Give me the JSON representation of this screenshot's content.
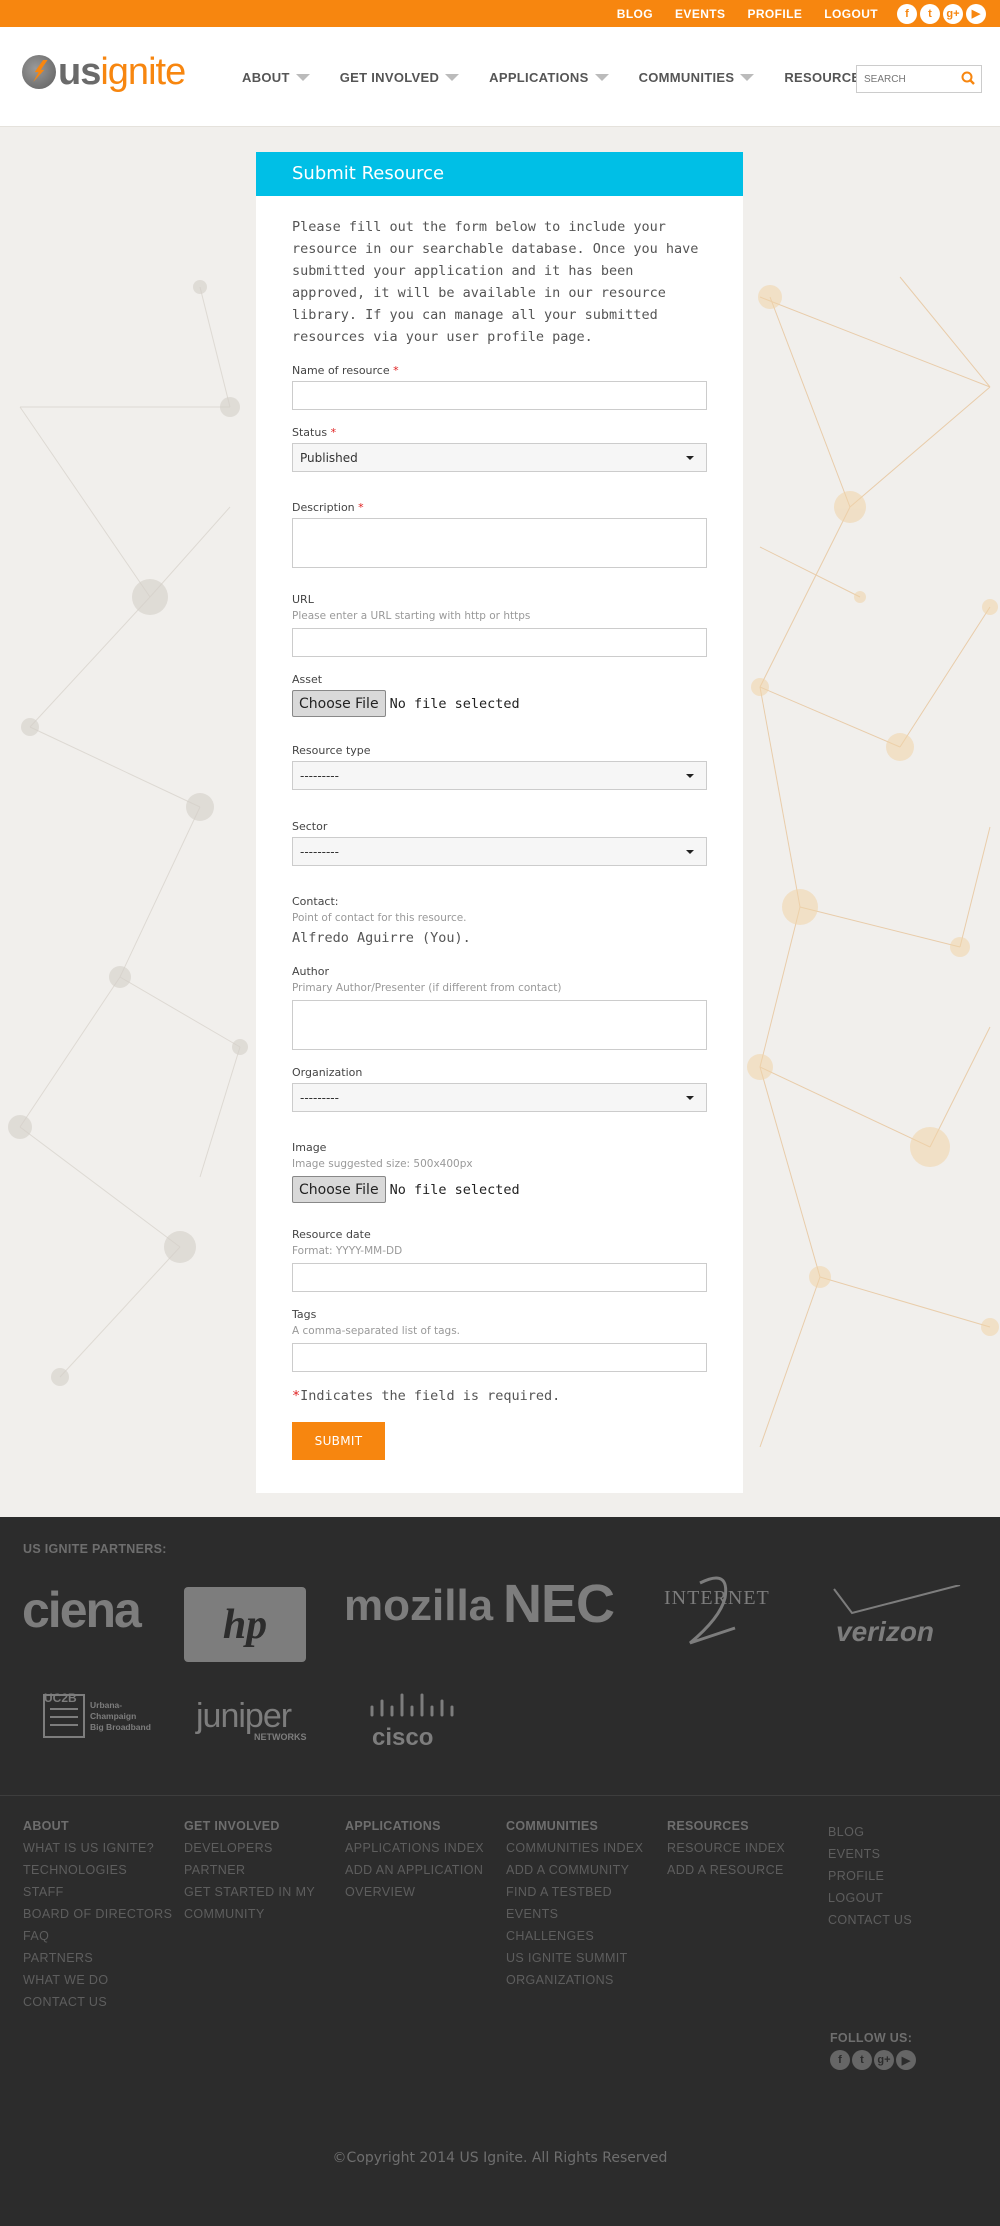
{
  "top_links": [
    "BLOG",
    "EVENTS",
    "PROFILE",
    "LOGOUT"
  ],
  "social_icons": [
    "facebook-icon",
    "twitter-icon",
    "googleplus-icon",
    "youtube-icon"
  ],
  "logo": {
    "us": "us",
    "ignite": "ignite"
  },
  "nav": [
    "ABOUT",
    "GET INVOLVED",
    "APPLICATIONS",
    "COMMUNITIES",
    "RESOURCES"
  ],
  "search": {
    "placeholder": "SEARCH"
  },
  "form": {
    "title": "Submit Resource",
    "intro": "Please fill out the form below to include your resource in our searchable database. Once you have submitted your application and it has been approved, it will be available in our resource library. If you can manage all your submitted resources via your user profile page.",
    "name_label": "Name of resource",
    "status_label": "Status",
    "status_value": "Published",
    "description_label": "Description",
    "url_label": "URL",
    "url_help": "Please enter a URL starting with http or https",
    "asset_label": "Asset",
    "choose_file": "Choose File",
    "no_file": "No file selected",
    "resource_type_label": "Resource type",
    "resource_type_value": "---------",
    "sector_label": "Sector",
    "sector_value": "---------",
    "contact_label": "Contact:",
    "contact_help": "Point of contact for this resource.",
    "contact_value": "Alfredo Aguirre (You).",
    "author_label": "Author",
    "author_help": "Primary Author/Presenter (if different from contact)",
    "organization_label": "Organization",
    "organization_value": "---------",
    "image_label": "Image",
    "image_help": "Image suggested size: 500x400px",
    "date_label": "Resource date",
    "date_help": "Format: YYYY-MM-DD",
    "tags_label": "Tags",
    "tags_help": "A comma-separated list of tags.",
    "required_star": "*",
    "required_note": "Indicates the field is required.",
    "submit": "SUBMIT"
  },
  "partners": {
    "title": "US IGNITE PARTNERS:",
    "logos": [
      "ciena",
      "hp",
      "mozilla",
      "NEC",
      "INTERNET",
      "verizon",
      "UC2B",
      "JUNIPER",
      "NETWORKS",
      "cisco"
    ],
    "uc2b_sub": "Urbana-Champaign Big Broadband"
  },
  "footer_columns": [
    {
      "title": "ABOUT",
      "links": [
        "WHAT IS US IGNITE?",
        "TECHNOLOGIES",
        "STAFF",
        "BOARD OF DIRECTORS",
        "FAQ",
        "PARTNERS",
        "WHAT WE DO",
        "CONTACT US"
      ]
    },
    {
      "title": "GET INVOLVED",
      "links": [
        "DEVELOPERS",
        "PARTNER",
        "GET STARTED IN MY",
        "COMMUNITY"
      ]
    },
    {
      "title": "APPLICATIONS",
      "links": [
        "APPLICATIONS INDEX",
        "ADD AN APPLICATION",
        "OVERVIEW"
      ]
    },
    {
      "title": "COMMUNITIES",
      "links": [
        "COMMUNITIES INDEX",
        "ADD A COMMUNITY",
        "FIND A TESTBED",
        "EVENTS",
        "CHALLENGES",
        "US IGNITE SUMMIT",
        "ORGANIZATIONS"
      ]
    },
    {
      "title": "RESOURCES",
      "links": [
        "RESOURCE INDEX",
        "ADD A RESOURCE"
      ]
    },
    {
      "title": "",
      "links": [
        "BLOG",
        "EVENTS",
        "PROFILE",
        "LOGOUT",
        "CONTACT US"
      ]
    }
  ],
  "follow_us": "FOLLOW US:",
  "copyright": "©Copyright 2014 US Ignite. All Rights Reserved",
  "colors": {
    "accent": "#f7860f",
    "header_blue": "#00bfe6",
    "footer_bg": "#2c2c2c"
  }
}
